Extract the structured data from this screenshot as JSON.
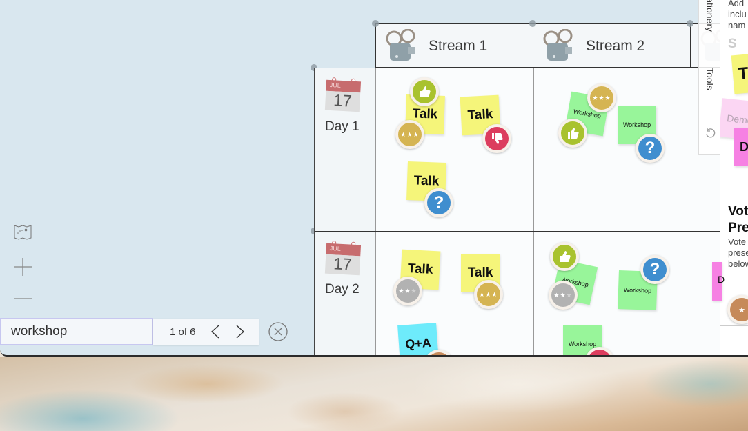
{
  "board": {
    "streams": [
      {
        "label": "Stream 1",
        "icon": "film-projector-icon"
      },
      {
        "label": "Stream 2",
        "icon": "film-projector-icon"
      },
      {
        "label": "S",
        "icon": "film-projector-icon"
      }
    ],
    "days": [
      {
        "label": "Day 1",
        "calendar_month": "JUL",
        "calendar_day": "17"
      },
      {
        "label": "Day 2",
        "calendar_month": "JUL",
        "calendar_day": "17"
      }
    ],
    "cells": {
      "day1_stream1": [
        {
          "type": "talk",
          "text": "Talk",
          "badges": [
            "thumbs-up",
            "3-stars"
          ]
        },
        {
          "type": "talk",
          "text": "Talk",
          "badges": [
            "thumbs-down"
          ]
        },
        {
          "type": "talk",
          "text": "Talk",
          "badges": [
            "question"
          ]
        }
      ],
      "day1_stream2": [
        {
          "type": "workshop",
          "text": "Workshop",
          "badges": [
            "3-stars",
            "thumbs-up"
          ]
        },
        {
          "type": "workshop",
          "text": "Workshop",
          "badges": [
            "question"
          ]
        }
      ],
      "day2_stream1": [
        {
          "type": "talk",
          "text": "Talk",
          "badges": [
            "2-stars"
          ]
        },
        {
          "type": "talk",
          "text": "Talk",
          "badges": [
            "3-stars"
          ]
        },
        {
          "type": "qa",
          "text": "Q+A",
          "badges": [
            "bronze"
          ]
        }
      ],
      "day2_stream2": [
        {
          "type": "workshop",
          "text": "Workshop",
          "badges": [
            "thumbs-up",
            "2-stars"
          ]
        },
        {
          "type": "workshop",
          "text": "Workshop",
          "badges": [
            "question"
          ]
        },
        {
          "type": "workshop",
          "text": "Workshop",
          "badges": [
            "thumbs-down"
          ]
        }
      ]
    },
    "star_glyphs": {
      "three": "★★★",
      "two_lit": "★★",
      "one_dim": "★",
      "one_lit": "★"
    },
    "question_glyph": "?"
  },
  "side_tabs": [
    {
      "label": "Stationery"
    },
    {
      "label": "Tools"
    },
    {
      "label": "undo",
      "icon": "undo-icon"
    }
  ],
  "side_panel": {
    "intro_lines": [
      "Add",
      "inclu",
      "nam"
    ],
    "stream_partial": "S",
    "talk_partial": "T",
    "demo_label": "Demo",
    "demo_partial": "D",
    "vote_title_lines": [
      "Vot",
      "Pre"
    ],
    "vote_desc_lines": [
      "Vote",
      "prese",
      "below"
    ]
  },
  "controls": {
    "map_icon": "treasure-map-icon",
    "zoom_in": "+",
    "zoom_out": "−"
  },
  "find": {
    "query": "workshop",
    "count_text": "1 of 6",
    "prev": "‹",
    "next": "›"
  }
}
